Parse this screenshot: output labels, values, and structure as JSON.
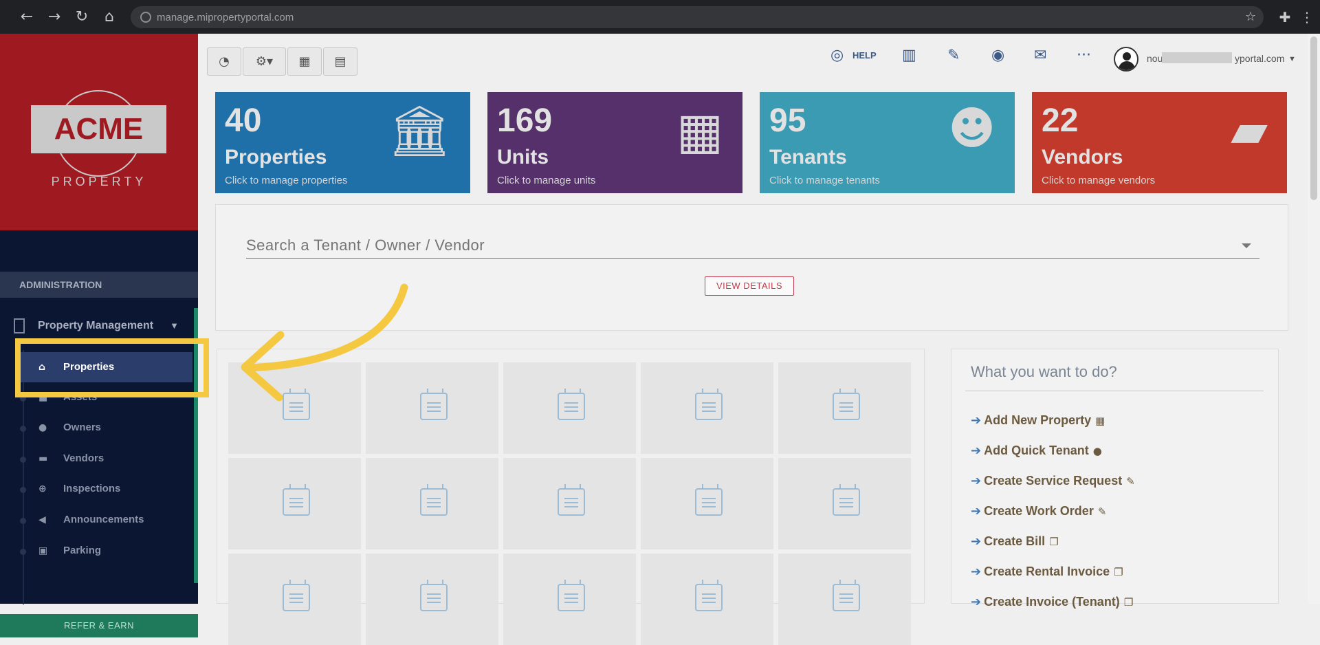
{
  "browser": {
    "url": "manage.mipropertyportal.com"
  },
  "brand": {
    "logo_text": "ACME",
    "logo_sub": "PROPERTY",
    "colors": {
      "logo_bg": "#9e1a20",
      "sidebar_bg": "#0b1633",
      "accent": "#f5c842"
    }
  },
  "sidebar": {
    "section": "ADMINISTRATION",
    "group_label": "Property Management",
    "items": [
      {
        "label": "Properties",
        "icon": "home-icon",
        "active": true
      },
      {
        "label": "Assets",
        "icon": "box-icon"
      },
      {
        "label": "Owners",
        "icon": "user-icon"
      },
      {
        "label": "Vendors",
        "icon": "briefcase-icon"
      },
      {
        "label": "Inspections",
        "icon": "search-plus-icon"
      },
      {
        "label": "Announcements",
        "icon": "bullhorn-icon"
      },
      {
        "label": "Parking",
        "icon": "car-icon"
      }
    ],
    "refer_label": "REFER & EARN"
  },
  "topbar": {
    "help_label": "HELP",
    "user_prefix": "nou",
    "user_suffix": "yportal.com"
  },
  "stats": [
    {
      "value": "40",
      "label": "Properties",
      "sub": "Click to manage properties",
      "color": "#1f6fa8",
      "icon": "bank-icon"
    },
    {
      "value": "169",
      "label": "Units",
      "sub": "Click to manage units",
      "color": "#56306b",
      "icon": "building-icon"
    },
    {
      "value": "95",
      "label": "Tenants",
      "sub": "Click to manage tenants",
      "color": "#3b9bb3",
      "icon": "users-icon"
    },
    {
      "value": "22",
      "label": "Vendors",
      "sub": "Click to manage vendors",
      "color": "#c0392b",
      "icon": "suitcase-icon"
    }
  ],
  "search": {
    "placeholder": "Search a Tenant / Owner / Vendor",
    "button": "VIEW DETAILS"
  },
  "todo": {
    "title": "What you want to do?",
    "items": [
      {
        "label": "Add New Property",
        "icon": "building-icon"
      },
      {
        "label": "Add Quick Tenant",
        "icon": "user-icon"
      },
      {
        "label": "Create Service Request",
        "icon": "wrench-icon"
      },
      {
        "label": "Create Work Order",
        "icon": "wrench-icon"
      },
      {
        "label": "Create Bill",
        "icon": "copy-icon"
      },
      {
        "label": "Create Rental Invoice",
        "icon": "copy-icon"
      },
      {
        "label": "Create Invoice (Tenant)",
        "icon": "copy-icon"
      }
    ]
  }
}
